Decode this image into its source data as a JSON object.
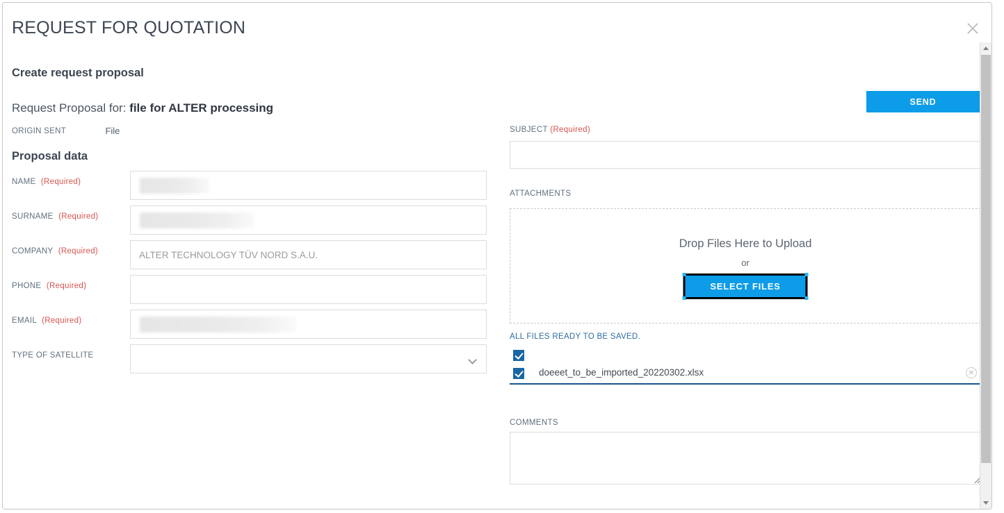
{
  "dialog": {
    "title": "REQUEST FOR QUOTATION",
    "close_icon": "close-icon",
    "section_create": "Create request proposal",
    "request_proposal_prefix": "Request Proposal for:",
    "request_proposal_name": "file for ALTER processing",
    "origin_sent_label": "ORIGIN SENT",
    "origin_sent_value": "File",
    "section_proposal_data": "Proposal data"
  },
  "form": {
    "required_suffix": "(Required)",
    "fields": [
      {
        "label": "NAME",
        "required": true,
        "value": "",
        "placeholder": "",
        "redacted": true,
        "redact_width": 100,
        "type": "text"
      },
      {
        "label": "SURNAME",
        "required": true,
        "value": "",
        "placeholder": "",
        "redacted": true,
        "redact_width": 165,
        "type": "text"
      },
      {
        "label": "COMPANY",
        "required": true,
        "value": "",
        "placeholder": "ALTER TECHNOLOGY TÜV NORD S.A.U.",
        "redacted": false,
        "redact_width": 0,
        "type": "text"
      },
      {
        "label": "PHONE",
        "required": true,
        "value": "",
        "placeholder": "",
        "redacted": false,
        "redact_width": 0,
        "type": "text"
      },
      {
        "label": "EMAIL",
        "required": true,
        "value": "",
        "placeholder": "",
        "redacted": true,
        "redact_width": 225,
        "type": "text"
      },
      {
        "label": "TYPE OF SATELLITE",
        "required": false,
        "value": "",
        "placeholder": "",
        "redacted": false,
        "redact_width": 0,
        "type": "select"
      }
    ]
  },
  "right": {
    "send_label": "SEND",
    "subject_label": "SUBJECT",
    "subject_value": "",
    "subject_placeholder": "",
    "attachments_label": "ATTACHMENTS",
    "dropzone_text": "Drop Files Here to Upload",
    "dropzone_or": "or",
    "select_files_label": "SELECT FILES",
    "files_ready_text": "ALL FILES READY TO BE SAVED.",
    "files": [
      {
        "name": "",
        "checked": true,
        "has_remove": false
      },
      {
        "name": "doeeet_to_be_imported_20220302.xlsx",
        "checked": true,
        "has_remove": true
      }
    ],
    "comments_label": "COMMENTS",
    "comments_value": "",
    "comments_placeholder": ""
  },
  "scrollbar": {
    "up_icon": "triangle-up-icon",
    "down_icon": "triangle-down-icon"
  },
  "colors": {
    "accent_blue": "#0d9ce8",
    "checkbox_blue": "#1866a3",
    "underline_blue": "#14548f",
    "required_red": "#d9534f",
    "label_gray": "#60707f"
  }
}
